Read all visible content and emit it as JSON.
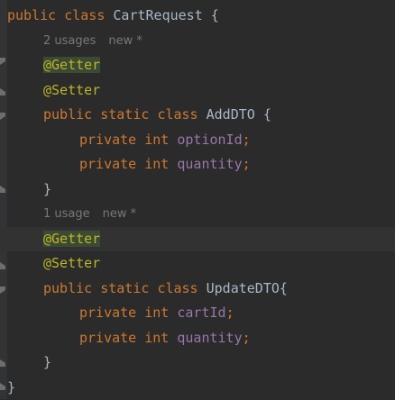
{
  "editor": {
    "lines": {
      "l1": {
        "kw1": "public",
        "kw2": "class",
        "name": "CartRequest",
        "brace": "{"
      },
      "hint1": {
        "usages": "2 usages",
        "status": "new *"
      },
      "l3": {
        "ann": "@Getter"
      },
      "l4": {
        "ann": "@Setter"
      },
      "l5": {
        "kw1": "public",
        "kw2": "static",
        "kw3": "class",
        "name": "AddDTO",
        "brace": "{"
      },
      "l6": {
        "kw1": "private",
        "type": "int",
        "field": "optionId",
        "semi": ";"
      },
      "l7": {
        "kw1": "private",
        "type": "int",
        "field": "quantity",
        "semi": ";"
      },
      "l8": {
        "brace": "}"
      },
      "hint2": {
        "usages": "1 usage",
        "status": "new *"
      },
      "l10": {
        "ann": "@Getter"
      },
      "l11": {
        "ann": "@Setter"
      },
      "l12": {
        "kw1": "public",
        "kw2": "static",
        "kw3": "class",
        "name": "UpdateDTO",
        "brace": "{"
      },
      "l13": {
        "kw1": "private",
        "type": "int",
        "field": "cartId",
        "semi": ";"
      },
      "l14": {
        "kw1": "private",
        "type": "int",
        "field": "quantity",
        "semi": ";"
      },
      "l15": {
        "brace": "}"
      },
      "l16": {
        "brace": "}"
      }
    }
  },
  "colors": {
    "background": "#2b2b2b",
    "keyword": "#cc7832",
    "identifier": "#a9b7c6",
    "field": "#9876aa",
    "annotation": "#bbb529",
    "hint": "#787878"
  }
}
